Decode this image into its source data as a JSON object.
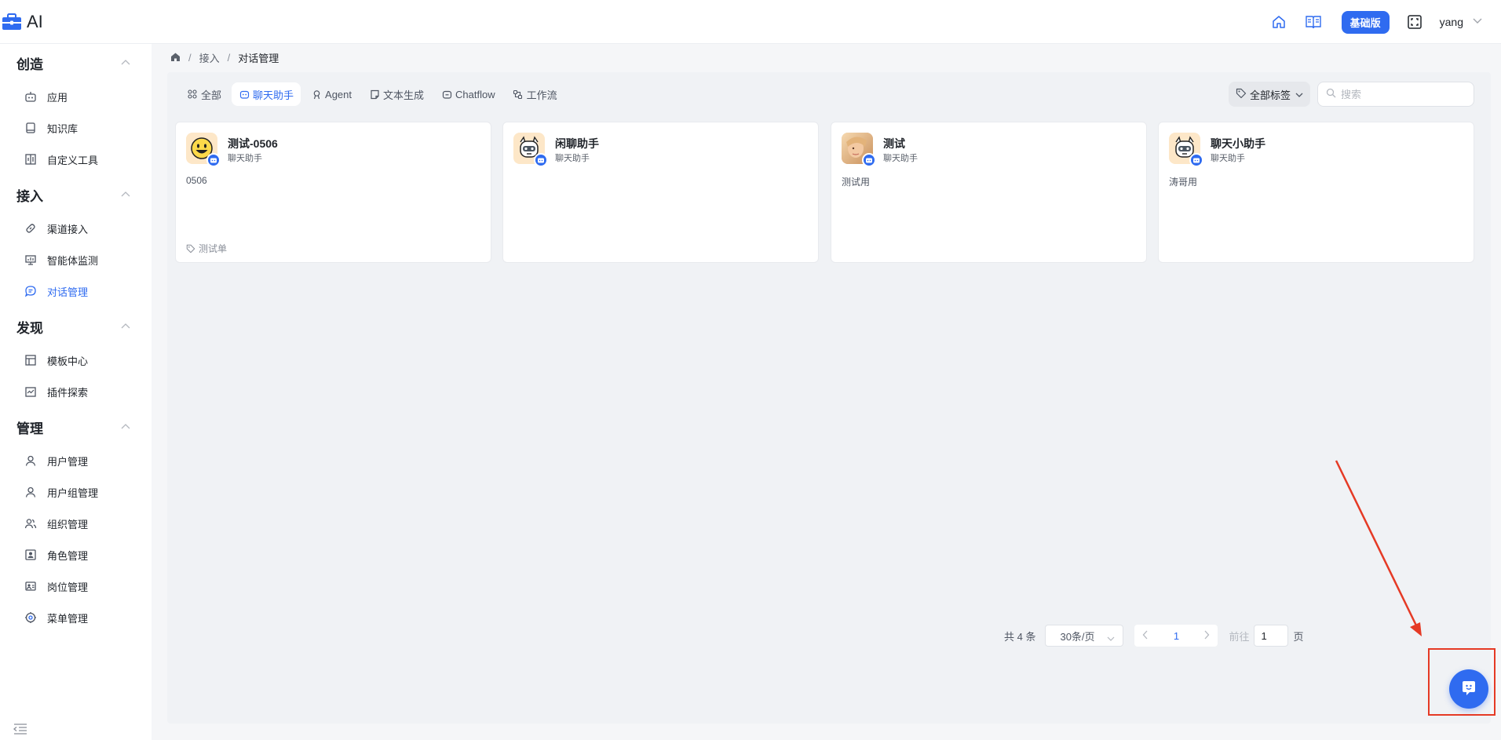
{
  "header": {
    "logo_text": "AI",
    "plan_badge": "基础版",
    "user_name": "yang",
    "icons": [
      "home-icon",
      "book-icon",
      "fullscreen-icon",
      "chevron-down-icon"
    ]
  },
  "breadcrumb": {
    "items": [
      "接入",
      "对话管理"
    ],
    "separator": "/"
  },
  "sidebar": {
    "groups": [
      {
        "title": "创造",
        "items": [
          {
            "label": "应用",
            "icon": "robot-icon"
          },
          {
            "label": "知识库",
            "icon": "book-icon"
          },
          {
            "label": "自定义工具",
            "icon": "tool-icon"
          }
        ]
      },
      {
        "title": "接入",
        "items": [
          {
            "label": "渠道接入",
            "icon": "link-icon"
          },
          {
            "label": "智能体监测",
            "icon": "monitor-icon"
          },
          {
            "label": "对话管理",
            "icon": "chat-icon"
          }
        ]
      },
      {
        "title": "发现",
        "items": [
          {
            "label": "模板中心",
            "icon": "template-icon"
          },
          {
            "label": "插件探索",
            "icon": "store-icon"
          }
        ]
      },
      {
        "title": "管理",
        "items": [
          {
            "label": "用户管理",
            "icon": "user-icon"
          },
          {
            "label": "用户组管理",
            "icon": "user-icon"
          },
          {
            "label": "组织管理",
            "icon": "team-icon"
          },
          {
            "label": "角色管理",
            "icon": "role-icon"
          },
          {
            "label": "岗位管理",
            "icon": "post-icon"
          },
          {
            "label": "菜单管理",
            "icon": "menu-icon"
          }
        ]
      }
    ],
    "active_item": "对话管理"
  },
  "tabs": [
    {
      "label": "全部",
      "icon": "grid-icon"
    },
    {
      "label": "聊天助手",
      "icon": "chatbot-icon"
    },
    {
      "label": "Agent",
      "icon": "agent-icon"
    },
    {
      "label": "文本生成",
      "icon": "note-icon"
    },
    {
      "label": "Chatflow",
      "icon": "chatflow-icon"
    },
    {
      "label": "工作流",
      "icon": "workflow-icon"
    }
  ],
  "active_tab": "聊天助手",
  "filter": {
    "tag_label": "全部标签",
    "search_placeholder": "搜索"
  },
  "cards": [
    {
      "title": "测试-0506",
      "type": "聊天助手",
      "desc": "0506",
      "tag": "测试单",
      "avatar": "smiley"
    },
    {
      "title": "闲聊助手",
      "type": "聊天助手",
      "desc": "",
      "tag": "",
      "avatar": "robot"
    },
    {
      "title": "测试",
      "type": "聊天助手",
      "desc": "测试用",
      "tag": "",
      "avatar": "photo"
    },
    {
      "title": "聊天小助手",
      "type": "聊天助手",
      "desc": "涛哥用",
      "tag": "",
      "avatar": "robot"
    }
  ],
  "pagination": {
    "total_text": "共 4 条",
    "page_size": "30条/页",
    "current_page": "1",
    "goto_label": "前往",
    "goto_value": "1",
    "page_suffix": "页"
  },
  "colors": {
    "accent": "#2f6bf0",
    "annotation": "#e53a25"
  }
}
